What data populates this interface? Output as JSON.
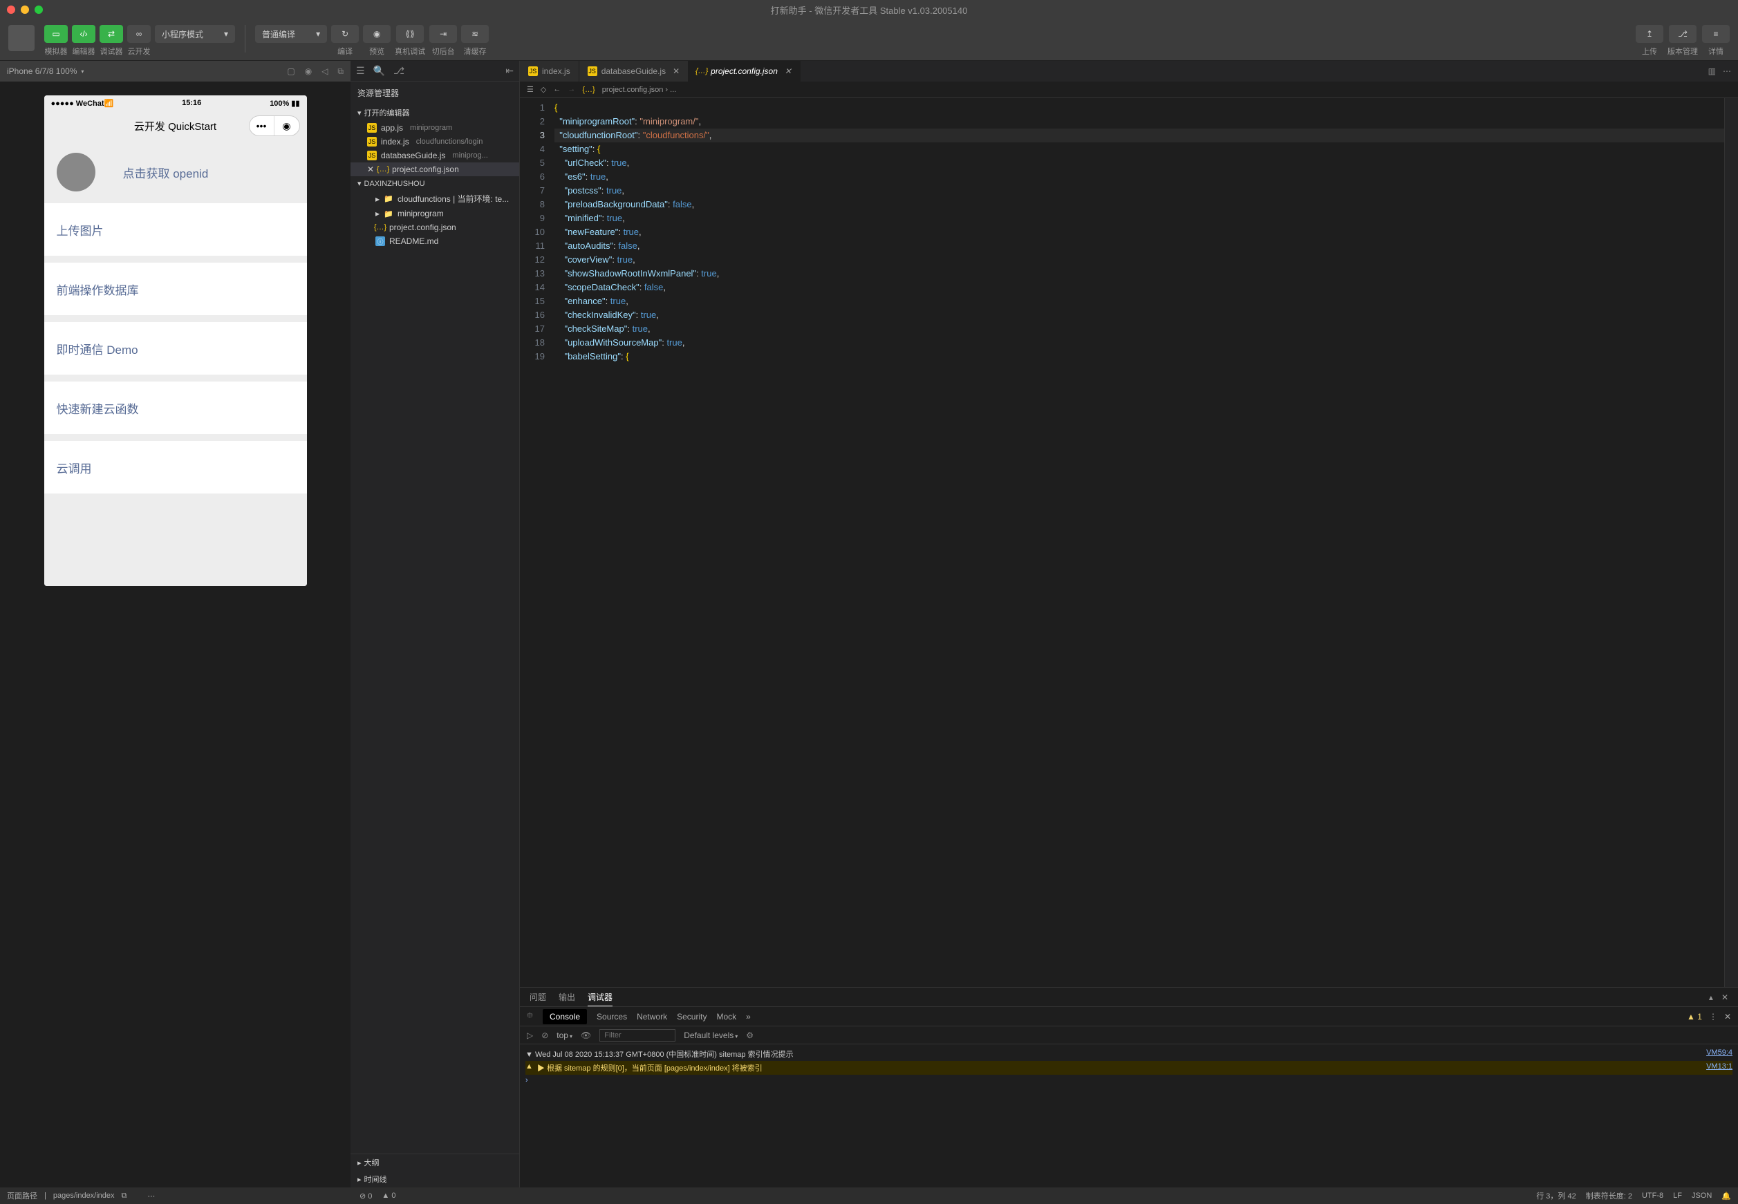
{
  "title": "打新助手 - 微信开发者工具 Stable v1.03.2005140",
  "toolbar": {
    "simulator": "模拟器",
    "editor": "编辑器",
    "debugger": "调试器",
    "cloud": "云开发",
    "mode": "小程序模式",
    "compile_mode": "普通编译",
    "compile": "编译",
    "preview": "预览",
    "remote": "真机调试",
    "background": "切后台",
    "cache": "清缓存",
    "upload": "上传",
    "version": "版本管理",
    "detail": "详情"
  },
  "sim": {
    "device": "iPhone 6/7/8 100%",
    "status_left": "●●●●● WeChat",
    "status_time": "15:16",
    "status_right": "100%",
    "nav_title": "云开发 QuickStart",
    "hero_link": "点击获取 openid",
    "items": [
      "上传图片",
      "前端操作数据库",
      "即时通信 Demo",
      "快速新建云函数",
      "云调用"
    ]
  },
  "explorer": {
    "title": "资源管理器",
    "open_editors": "打开的编辑器",
    "project": "DAXINZHUSHOU",
    "outline": "大纲",
    "timeline": "时间线",
    "open": [
      {
        "icon": "js",
        "name": "app.js",
        "hint": "miniprogram"
      },
      {
        "icon": "js",
        "name": "index.js",
        "hint": "cloudfunctions/login"
      },
      {
        "icon": "js",
        "name": "databaseGuide.js",
        "hint": "miniprog..."
      },
      {
        "icon": "json",
        "name": "project.config.json",
        "hint": "",
        "active": true
      }
    ],
    "tree": [
      {
        "icon": "folder",
        "name": "cloudfunctions | 当前环境: te...",
        "expandable": true
      },
      {
        "icon": "folder",
        "name": "miniprogram",
        "expandable": true
      },
      {
        "icon": "json",
        "name": "project.config.json"
      },
      {
        "icon": "md",
        "name": "README.md"
      }
    ]
  },
  "tabs": [
    {
      "icon": "js",
      "name": "index.js"
    },
    {
      "icon": "js",
      "name": "databaseGuide.js",
      "close": true
    },
    {
      "icon": "json",
      "name": "project.config.json",
      "active": true,
      "close": true
    }
  ],
  "breadcrumb": "project.config.json › ...",
  "code": {
    "lines": [
      [
        [
          "brace",
          "{"
        ]
      ],
      [
        [
          "p",
          "  "
        ],
        [
          "key",
          "\"miniprogramRoot\""
        ],
        [
          "p",
          ": "
        ],
        [
          "str",
          "\"miniprogram/\""
        ],
        [
          "p",
          ","
        ]
      ],
      [
        [
          "p",
          "  "
        ],
        [
          "key",
          "\"cloudfunctionRoot\""
        ],
        [
          "p",
          ": "
        ],
        [
          "str2",
          "\"cloudfunctions/\""
        ],
        [
          "p",
          ","
        ]
      ],
      [
        [
          "p",
          "  "
        ],
        [
          "key",
          "\"setting\""
        ],
        [
          "p",
          ": "
        ],
        [
          "brace",
          "{"
        ]
      ],
      [
        [
          "p",
          "    "
        ],
        [
          "key",
          "\"urlCheck\""
        ],
        [
          "p",
          ": "
        ],
        [
          "kw",
          "true"
        ],
        [
          "p",
          ","
        ]
      ],
      [
        [
          "p",
          "    "
        ],
        [
          "key",
          "\"es6\""
        ],
        [
          "p",
          ": "
        ],
        [
          "kw",
          "true"
        ],
        [
          "p",
          ","
        ]
      ],
      [
        [
          "p",
          "    "
        ],
        [
          "key",
          "\"postcss\""
        ],
        [
          "p",
          ": "
        ],
        [
          "kw",
          "true"
        ],
        [
          "p",
          ","
        ]
      ],
      [
        [
          "p",
          "    "
        ],
        [
          "key",
          "\"preloadBackgroundData\""
        ],
        [
          "p",
          ": "
        ],
        [
          "kw",
          "false"
        ],
        [
          "p",
          ","
        ]
      ],
      [
        [
          "p",
          "    "
        ],
        [
          "key",
          "\"minified\""
        ],
        [
          "p",
          ": "
        ],
        [
          "kw",
          "true"
        ],
        [
          "p",
          ","
        ]
      ],
      [
        [
          "p",
          "    "
        ],
        [
          "key",
          "\"newFeature\""
        ],
        [
          "p",
          ": "
        ],
        [
          "kw",
          "true"
        ],
        [
          "p",
          ","
        ]
      ],
      [
        [
          "p",
          "    "
        ],
        [
          "key",
          "\"autoAudits\""
        ],
        [
          "p",
          ": "
        ],
        [
          "kw",
          "false"
        ],
        [
          "p",
          ","
        ]
      ],
      [
        [
          "p",
          "    "
        ],
        [
          "key",
          "\"coverView\""
        ],
        [
          "p",
          ": "
        ],
        [
          "kw",
          "true"
        ],
        [
          "p",
          ","
        ]
      ],
      [
        [
          "p",
          "    "
        ],
        [
          "key",
          "\"showShadowRootInWxmlPanel\""
        ],
        [
          "p",
          ": "
        ],
        [
          "kw",
          "true"
        ],
        [
          "p",
          ","
        ]
      ],
      [
        [
          "p",
          "    "
        ],
        [
          "key",
          "\"scopeDataCheck\""
        ],
        [
          "p",
          ": "
        ],
        [
          "kw",
          "false"
        ],
        [
          "p",
          ","
        ]
      ],
      [
        [
          "p",
          "    "
        ],
        [
          "key",
          "\"enhance\""
        ],
        [
          "p",
          ": "
        ],
        [
          "kw",
          "true"
        ],
        [
          "p",
          ","
        ]
      ],
      [
        [
          "p",
          "    "
        ],
        [
          "key",
          "\"checkInvalidKey\""
        ],
        [
          "p",
          ": "
        ],
        [
          "kw",
          "true"
        ],
        [
          "p",
          ","
        ]
      ],
      [
        [
          "p",
          "    "
        ],
        [
          "key",
          "\"checkSiteMap\""
        ],
        [
          "p",
          ": "
        ],
        [
          "kw",
          "true"
        ],
        [
          "p",
          ","
        ]
      ],
      [
        [
          "p",
          "    "
        ],
        [
          "key",
          "\"uploadWithSourceMap\""
        ],
        [
          "p",
          ": "
        ],
        [
          "kw",
          "true"
        ],
        [
          "p",
          ","
        ]
      ],
      [
        [
          "p",
          "    "
        ],
        [
          "key",
          "\"babelSetting\""
        ],
        [
          "p",
          ": "
        ],
        [
          "brace",
          "{"
        ]
      ]
    ],
    "active_line": 3
  },
  "devtools": {
    "t_problems": "问题",
    "t_output": "输出",
    "t_debugger": "调试器",
    "c_console": "Console",
    "c_sources": "Sources",
    "c_network": "Network",
    "c_security": "Security",
    "c_mock": "Mock",
    "warn_count": "1",
    "scope": "top",
    "filter_placeholder": "Filter",
    "levels": "Default levels",
    "log1": "▼  Wed Jul 08 2020 15:13:37 GMT+0800 (中国标准时间) sitemap 索引情况提示",
    "log1_src": "VM59:4",
    "log2": "▶ 根据 sitemap 的规则[0]，当前页面 [pages/index/index] 将被索引",
    "log2_src": "VM13:1",
    "prompt": "›"
  },
  "statusbar": {
    "path_label": "页面路径",
    "path": "pages/index/index",
    "errors": "0",
    "warnings": "0",
    "pos": "行 3，列 42",
    "tab": "制表符长度: 2",
    "enc": "UTF-8",
    "eol": "LF",
    "lang": "JSON"
  }
}
